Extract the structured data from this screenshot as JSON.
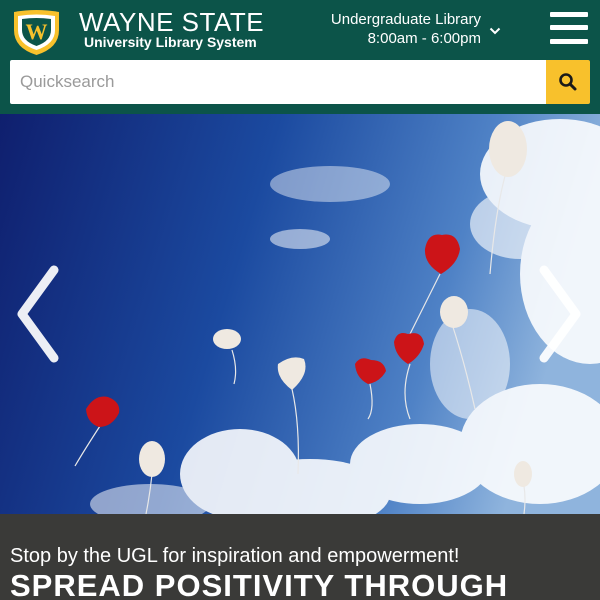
{
  "brand": {
    "title": "WAYNE STATE",
    "subtitle": "University Library System",
    "logo_letter": "W"
  },
  "library": {
    "name": "Undergraduate Library",
    "hours": "8:00am - 6:00pm"
  },
  "search": {
    "placeholder": "Quicksearch",
    "value": ""
  },
  "carousel": {
    "slide_caption": {
      "subtitle": "Stop by the UGL for inspiration and empowerment!",
      "headline": "SPREAD POSITIVITY THROUGH"
    }
  },
  "icons": {
    "logo": "wayne-state-shield-icon",
    "library_dropdown": "chevron-down-icon",
    "menu": "hamburger-menu-icon",
    "search": "search-icon",
    "prev": "chevron-left-icon",
    "next": "chevron-right-icon"
  },
  "colors": {
    "header_bg": "#0c5449",
    "accent": "#f8c12c",
    "caption_bg": "#3a3a38"
  }
}
